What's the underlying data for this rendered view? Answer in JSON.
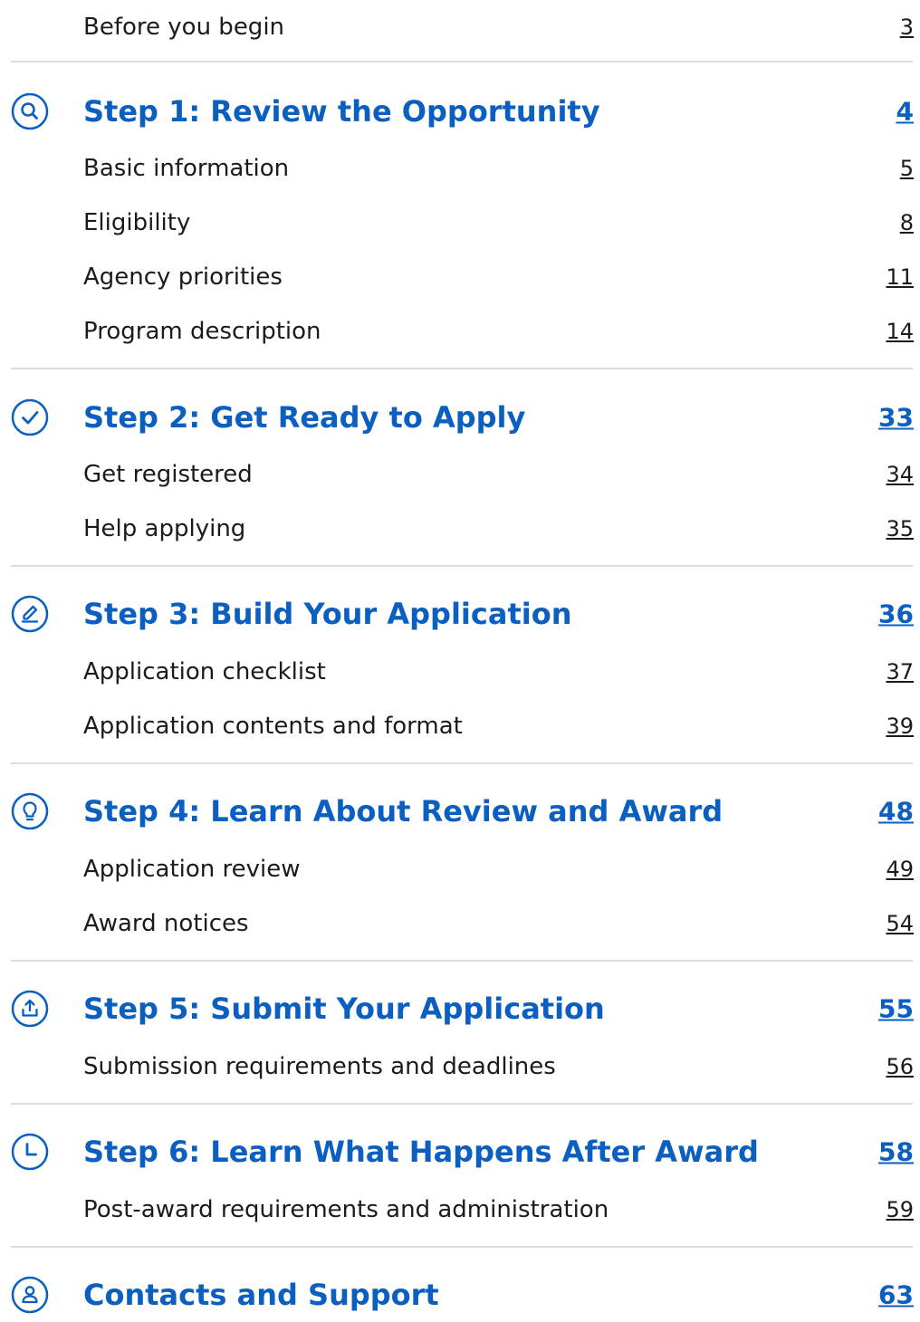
{
  "before": {
    "label": "Before you begin",
    "page": "3"
  },
  "step1": {
    "title": "Step 1: Review the Opportunity",
    "page": "4",
    "icon": "search-icon",
    "items": [
      {
        "label": "Basic information",
        "page": "5"
      },
      {
        "label": "Eligibility",
        "page": "8"
      },
      {
        "label": "Agency priorities",
        "page": "11"
      },
      {
        "label": "Program description",
        "page": "14"
      }
    ]
  },
  "step2": {
    "title": "Step 2: Get Ready to Apply",
    "page": "33",
    "icon": "check-circle-icon",
    "items": [
      {
        "label": "Get registered",
        "page": "34"
      },
      {
        "label": "Help applying",
        "page": "35"
      }
    ]
  },
  "step3": {
    "title": "Step 3: Build Your Application",
    "page": "36",
    "icon": "pencil-icon",
    "items": [
      {
        "label": "Application checklist",
        "page": "37"
      },
      {
        "label": "Application contents and format",
        "page": "39"
      }
    ]
  },
  "step4": {
    "title": "Step 4: Learn About Review and Award",
    "page": "48",
    "icon": "lightbulb-icon",
    "items": [
      {
        "label": "Application review",
        "page": "49"
      },
      {
        "label": "Award notices",
        "page": "54"
      }
    ]
  },
  "step5": {
    "title": "Step 5: Submit Your Application",
    "page": "55",
    "icon": "upload-icon",
    "items": [
      {
        "label": "Submission requirements and deadlines",
        "page": "56"
      }
    ]
  },
  "step6": {
    "title": "Step 6: Learn What Happens After Award",
    "page": "58",
    "icon": "clock-icon",
    "items": [
      {
        "label": "Post-award requirements and administration",
        "page": "59"
      }
    ]
  },
  "contacts": {
    "title": "Contacts and Support",
    "page": "63",
    "icon": "person-icon"
  },
  "colors": {
    "accent": "#0b5fc1",
    "text": "#1b1b1b",
    "divider": "#d9dde2"
  }
}
